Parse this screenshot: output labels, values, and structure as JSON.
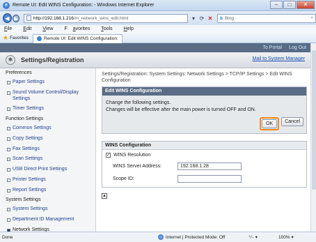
{
  "window": {
    "title": "Remote UI: Edit WINS Configuration: - Windows Internet Explorer",
    "ie_glyph": "e",
    "buttons": [
      "–",
      "□",
      "✕"
    ]
  },
  "nav": {
    "back_icon": "◀",
    "forward_icon": "▶",
    "url_host": "http://192.168.1.216",
    "url_path": "/m_network_wins_edit.html",
    "dropdown_icon": "▾",
    "refresh_icon": "⟳",
    "stop_icon": "✕",
    "search_brand": "b",
    "search_placeholder": "Bing",
    "search_icon": "⌕"
  },
  "menu": [
    {
      "key": "F",
      "rest": "ile",
      "pre": ""
    },
    {
      "key": "E",
      "rest": "dit",
      "pre": ""
    },
    {
      "key": "V",
      "rest": "iew",
      "pre": ""
    },
    {
      "key": "a",
      "rest": "vorites",
      "pre": "F"
    },
    {
      "key": "T",
      "rest": "ools",
      "pre": ""
    },
    {
      "key": "H",
      "rest": "elp",
      "pre": ""
    }
  ],
  "favorites": {
    "label": "Favorites",
    "star_icon": "★",
    "tab_title": "Remote UI: Edit WINS Configuration:"
  },
  "page": {
    "top_links": {
      "portal": "To Portal",
      "logout": "Log Out"
    },
    "title": "Settings/Registration",
    "logo_glyph": "✱",
    "mail_link": "Mail to System Manager",
    "sidebar": [
      {
        "type": "section",
        "label": "Preferences"
      },
      {
        "type": "item",
        "label": "Paper Settings"
      },
      {
        "type": "item",
        "label": "Sound Volume Control/Display Settings"
      },
      {
        "type": "item",
        "label": "Timer Settings"
      },
      {
        "type": "section",
        "label": "Function Settings"
      },
      {
        "type": "item",
        "label": "Common Settings"
      },
      {
        "type": "item",
        "label": "Copy Settings"
      },
      {
        "type": "item",
        "label": "Fax Settings"
      },
      {
        "type": "item",
        "label": "Scan Settings"
      },
      {
        "type": "item",
        "label": "USB Direct Print Settings"
      },
      {
        "type": "item",
        "label": "Printer Settings"
      },
      {
        "type": "item",
        "label": "Report Settings"
      },
      {
        "type": "section",
        "label": "System Settings"
      },
      {
        "type": "item",
        "label": "System Settings"
      },
      {
        "type": "item",
        "label": "Department ID Management"
      },
      {
        "type": "item",
        "label": "Network Settings",
        "active": true
      }
    ],
    "breadcrumb": "Settings/Registration: System Settings: Network Settings > TCP/IP Settings > Edit WINS Configuration",
    "panel": {
      "title": "Edit WINS Configuration",
      "line1": "Change the following settings.",
      "line2": "Changes will be effective after the main power is turned OFF and ON.",
      "ok": "OK",
      "cancel": "Cancel"
    },
    "wins": {
      "title": "WINS Configuration",
      "resolution_label": "WINS Resolution",
      "check_mark": "✓",
      "server_label": "WINS Server Address:",
      "server_value": "192.168.1.28",
      "scope_label": "Scope ID:",
      "scope_value": "",
      "page_top_glyph": "▲"
    }
  },
  "status": {
    "left": "Done",
    "zone": "Internet | Protected Mode: Off",
    "zoom_controls": "⁺⁄₋ ▾",
    "zoom": "100%",
    "zoom_dropdown": "▾"
  }
}
